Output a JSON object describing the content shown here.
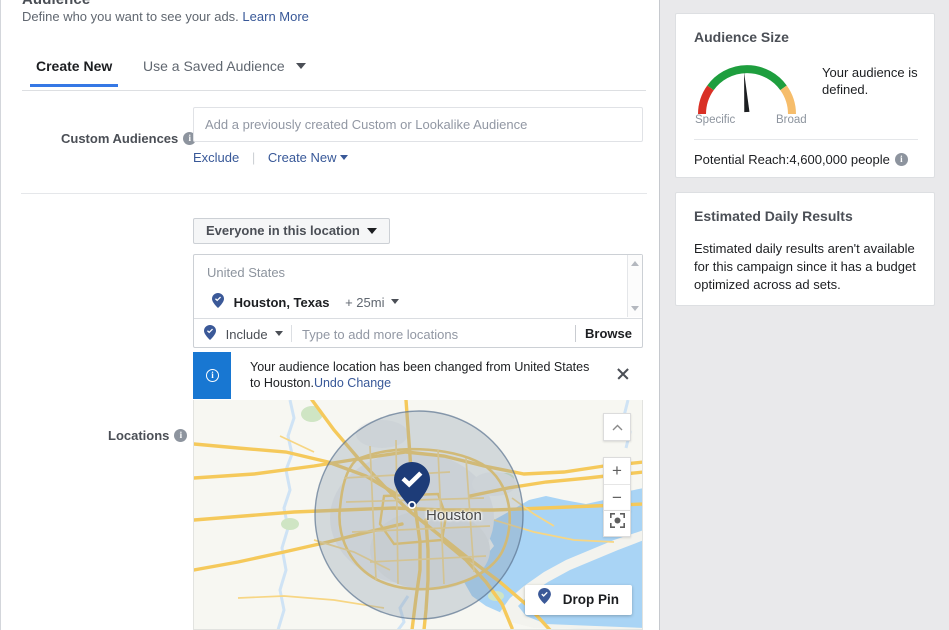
{
  "section": {
    "title": "Audience",
    "subtitle": "Define who you want to see your ads.",
    "learn_more": "Learn More"
  },
  "tabs": [
    {
      "label": "Create New",
      "active": true
    },
    {
      "label": "Use a Saved Audience",
      "active": false
    }
  ],
  "custom_audiences": {
    "label": "Custom Audiences",
    "info_icon": "info-icon",
    "placeholder": "Add a previously created Custom or Lookalike Audience",
    "value": "",
    "exclude_link": "Exclude",
    "create_new_link": "Create New"
  },
  "locations": {
    "label": "Locations",
    "info_icon": "info-icon",
    "audience_scope": "Everyone in this location",
    "list": {
      "country": "United States",
      "city": "Houston, Texas",
      "radius": "+ 25mi",
      "pin_icon": "map-pin-check-icon"
    },
    "input_row": {
      "mode": "Include",
      "mode_icon": "map-pin-check-icon",
      "placeholder": "Type to add more locations",
      "value": "",
      "browse": "Browse"
    },
    "notification": {
      "icon": "info-icon",
      "message": "Your audience location has been changed from United States to Houston.",
      "undo_link": "Undo Change",
      "close_icon": "close-icon"
    },
    "map": {
      "city_label": "Houston",
      "pin_icon": "map-pin-check-icon",
      "drop_pin_button": "Drop Pin",
      "drop_pin_icon": "map-pin-check-icon",
      "controls": {
        "collapse_icon": "chevron-up-icon",
        "zoom_in": "+",
        "zoom_out": "−",
        "locate_icon": "fullscreen-icon"
      },
      "colors": {
        "land": "#f7f7f2",
        "water": "#a9d4f5",
        "road": "#f5c95b",
        "park": "#cfe5c4",
        "radius_fill": "#8c9eb0",
        "radius_stroke": "#5b7490",
        "pin": "#1d3c78"
      }
    }
  },
  "audience_size": {
    "title": "Audience Size",
    "gauge": {
      "low_label": "Specific",
      "high_label": "Broad",
      "needle_angle_deg": -4,
      "colors": {
        "low": "#d93025",
        "mid": "#1e9e3e",
        "high": "#f6bd6b"
      }
    },
    "message": "Your audience is defined.",
    "reach_label": "Potential Reach:",
    "reach_value": "4,600,000 people",
    "reach_info_icon": "info-icon"
  },
  "estimated_daily_results": {
    "title": "Estimated Daily Results",
    "body": "Estimated daily results aren't available for this campaign since it has a budget optimized across ad sets."
  },
  "accent": "#3578e5",
  "link_color": "#385898"
}
